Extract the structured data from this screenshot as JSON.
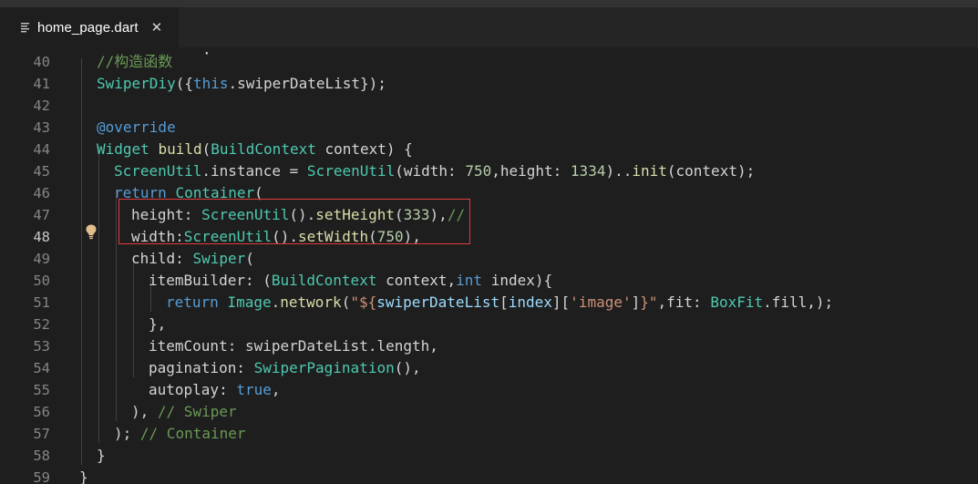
{
  "tab": {
    "filename": "home_page.dart",
    "close_glyph": "✕",
    "icon": "file-lines-icon"
  },
  "active_line": 48,
  "colors": {
    "background": "#1e1e1e",
    "tabbar": "#252526",
    "keyword": "#569cd6",
    "type": "#4ec9b0",
    "function": "#dcdcaa",
    "number": "#b5cea8",
    "string": "#ce9178",
    "comment": "#6a9955",
    "highlight_box": "#e03b3b",
    "lightbulb": "#e2c08d"
  },
  "lines": [
    {
      "num": "40",
      "indent": 1,
      "tokens": [
        {
          "t": "//构造函数",
          "c": "cm"
        }
      ]
    },
    {
      "num": "41",
      "indent": 1,
      "tokens": [
        {
          "t": "SwiperDiy",
          "c": "ty"
        },
        {
          "t": "({",
          "c": "pl"
        },
        {
          "t": "this",
          "c": "kw"
        },
        {
          "t": ".swiperDateList});",
          "c": "pl"
        }
      ]
    },
    {
      "num": "42",
      "indent": 0,
      "tokens": []
    },
    {
      "num": "43",
      "indent": 1,
      "tokens": [
        {
          "t": "@override",
          "c": "kw"
        }
      ]
    },
    {
      "num": "44",
      "indent": 1,
      "tokens": [
        {
          "t": "Widget",
          "c": "ty"
        },
        {
          "t": " ",
          "c": "pl"
        },
        {
          "t": "build",
          "c": "fn"
        },
        {
          "t": "(",
          "c": "pl"
        },
        {
          "t": "BuildContext",
          "c": "ty"
        },
        {
          "t": " context) {",
          "c": "pl"
        }
      ]
    },
    {
      "num": "45",
      "indent": 2,
      "tokens": [
        {
          "t": "ScreenUtil",
          "c": "ty"
        },
        {
          "t": ".instance = ",
          "c": "pl"
        },
        {
          "t": "ScreenUtil",
          "c": "ty"
        },
        {
          "t": "(width: ",
          "c": "pl"
        },
        {
          "t": "750",
          "c": "num"
        },
        {
          "t": ",height: ",
          "c": "pl"
        },
        {
          "t": "1334",
          "c": "num"
        },
        {
          "t": ")..",
          "c": "pl"
        },
        {
          "t": "init",
          "c": "fn"
        },
        {
          "t": "(context);",
          "c": "pl"
        }
      ]
    },
    {
      "num": "46",
      "indent": 2,
      "tokens": [
        {
          "t": "return",
          "c": "kw"
        },
        {
          "t": " ",
          "c": "pl"
        },
        {
          "t": "Container",
          "c": "ty"
        },
        {
          "t": "(",
          "c": "pl"
        }
      ]
    },
    {
      "num": "47",
      "indent": 3,
      "tokens": [
        {
          "t": "height: ",
          "c": "pl"
        },
        {
          "t": "ScreenUtil",
          "c": "ty"
        },
        {
          "t": "().",
          "c": "pl"
        },
        {
          "t": "setHeight",
          "c": "fn"
        },
        {
          "t": "(",
          "c": "pl"
        },
        {
          "t": "333",
          "c": "num"
        },
        {
          "t": "),",
          "c": "pl"
        },
        {
          "t": "//",
          "c": "cm"
        }
      ]
    },
    {
      "num": "48",
      "indent": 3,
      "tokens": [
        {
          "t": "width:",
          "c": "pl"
        },
        {
          "t": "ScreenUtil",
          "c": "ty"
        },
        {
          "t": "().",
          "c": "pl"
        },
        {
          "t": "setWidth",
          "c": "fn"
        },
        {
          "t": "(",
          "c": "pl"
        },
        {
          "t": "750",
          "c": "num"
        },
        {
          "t": "),",
          "c": "pl"
        }
      ]
    },
    {
      "num": "49",
      "indent": 3,
      "tokens": [
        {
          "t": "child: ",
          "c": "pl"
        },
        {
          "t": "Swiper",
          "c": "ty"
        },
        {
          "t": "(",
          "c": "pl"
        }
      ]
    },
    {
      "num": "50",
      "indent": 4,
      "tokens": [
        {
          "t": "itemBuilder: (",
          "c": "pl"
        },
        {
          "t": "BuildContext",
          "c": "ty"
        },
        {
          "t": " context,",
          "c": "pl"
        },
        {
          "t": "int",
          "c": "kw"
        },
        {
          "t": " index){",
          "c": "pl"
        }
      ]
    },
    {
      "num": "51",
      "indent": 5,
      "tokens": [
        {
          "t": "return",
          "c": "kw"
        },
        {
          "t": " ",
          "c": "pl"
        },
        {
          "t": "Image",
          "c": "ty"
        },
        {
          "t": ".",
          "c": "pl"
        },
        {
          "t": "network",
          "c": "fn"
        },
        {
          "t": "(",
          "c": "pl"
        },
        {
          "t": "\"${",
          "c": "str"
        },
        {
          "t": "swiperDateList",
          "c": "pm"
        },
        {
          "t": "[",
          "c": "pl"
        },
        {
          "t": "index",
          "c": "pm"
        },
        {
          "t": "][",
          "c": "pl"
        },
        {
          "t": "'image'",
          "c": "str"
        },
        {
          "t": "]",
          "c": "pl"
        },
        {
          "t": "}\"",
          "c": "str"
        },
        {
          "t": ",fit: ",
          "c": "pl"
        },
        {
          "t": "BoxFit",
          "c": "ty"
        },
        {
          "t": ".fill,);",
          "c": "pl"
        }
      ]
    },
    {
      "num": "52",
      "indent": 4,
      "tokens": [
        {
          "t": "},",
          "c": "pl"
        }
      ]
    },
    {
      "num": "53",
      "indent": 4,
      "tokens": [
        {
          "t": "itemCount: swiperDateList.length,",
          "c": "pl"
        }
      ]
    },
    {
      "num": "54",
      "indent": 4,
      "tokens": [
        {
          "t": "pagination: ",
          "c": "pl"
        },
        {
          "t": "SwiperPagination",
          "c": "ty"
        },
        {
          "t": "(),",
          "c": "pl"
        }
      ]
    },
    {
      "num": "55",
      "indent": 4,
      "tokens": [
        {
          "t": "autoplay: ",
          "c": "pl"
        },
        {
          "t": "true",
          "c": "kw"
        },
        {
          "t": ",",
          "c": "pl"
        }
      ]
    },
    {
      "num": "56",
      "indent": 3,
      "tokens": [
        {
          "t": "), ",
          "c": "pl"
        },
        {
          "t": "// Swiper",
          "c": "cm"
        }
      ]
    },
    {
      "num": "57",
      "indent": 2,
      "tokens": [
        {
          "t": "); ",
          "c": "pl"
        },
        {
          "t": "// Container",
          "c": "cm"
        }
      ]
    },
    {
      "num": "58",
      "indent": 1,
      "tokens": [
        {
          "t": "}",
          "c": "pl"
        }
      ]
    },
    {
      "num": "59",
      "indent": 0,
      "tokens": [
        {
          "t": "}",
          "c": "pl"
        }
      ]
    }
  ]
}
